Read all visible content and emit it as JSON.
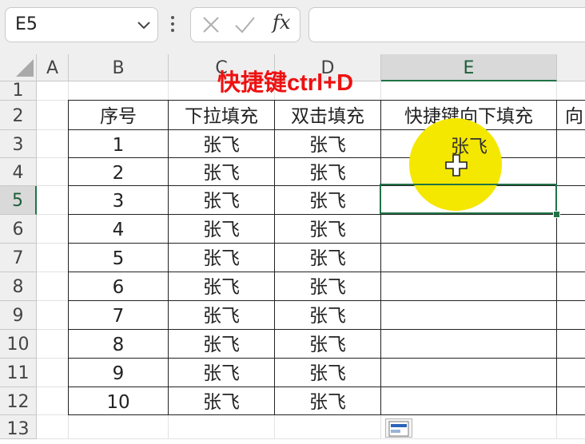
{
  "namebox": {
    "value": "E5"
  },
  "formula_bar": {
    "fx_label": "fx",
    "value": ""
  },
  "annotation": "快捷键ctrl+D",
  "columns": [
    "A",
    "B",
    "C",
    "D",
    "E"
  ],
  "selected_column": "E",
  "rows": [
    "1",
    "2",
    "3",
    "4",
    "5",
    "6",
    "7",
    "8",
    "9",
    "10",
    "11",
    "12",
    "13"
  ],
  "selected_row": "5",
  "table": {
    "headers": [
      "序号",
      "下拉填充",
      "双击填充",
      "快捷键向下填充",
      "向"
    ],
    "rows": [
      [
        "1",
        "张飞",
        "张飞",
        "张飞"
      ],
      [
        "2",
        "张飞",
        "张飞",
        ""
      ],
      [
        "3",
        "张飞",
        "张飞",
        ""
      ],
      [
        "4",
        "张飞",
        "张飞",
        ""
      ],
      [
        "5",
        "张飞",
        "张飞",
        ""
      ],
      [
        "6",
        "张飞",
        "张飞",
        ""
      ],
      [
        "7",
        "张飞",
        "张飞",
        ""
      ],
      [
        "8",
        "张飞",
        "张飞",
        ""
      ],
      [
        "9",
        "张飞",
        "张飞",
        ""
      ],
      [
        "10",
        "张飞",
        "张飞",
        ""
      ]
    ]
  },
  "icons": {
    "namebox_dropdown": "chevron-down-icon",
    "more": "vertical-dots-icon",
    "cancel": "x-icon",
    "enter": "check-icon",
    "function": "fx-icon",
    "cursor": "cross-cursor-icon",
    "fill_options": "auto-fill-options-icon"
  },
  "colors": {
    "selection": "#217346",
    "highlight": "#f4e700",
    "annotation": "#ee1111"
  }
}
